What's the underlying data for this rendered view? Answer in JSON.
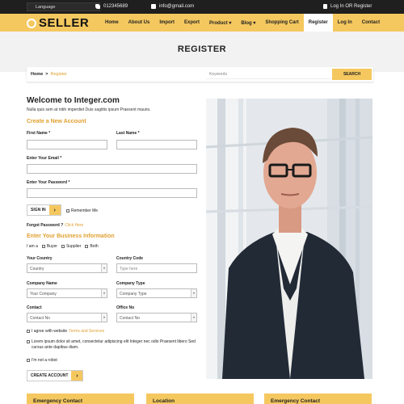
{
  "topbar": {
    "language": "Language",
    "phone": "012345689",
    "email": "info@gmail.com",
    "auth": "Log In OR Register"
  },
  "brand": {
    "name": "SELLER",
    "accent": "#f5c85f"
  },
  "nav": {
    "items": [
      {
        "label": "Home"
      },
      {
        "label": "About Us"
      },
      {
        "label": "Import"
      },
      {
        "label": "Export"
      },
      {
        "label": "Product ▾"
      },
      {
        "label": "Blog ▾"
      },
      {
        "label": "Shopping Cart"
      },
      {
        "label": "Register",
        "active": true
      },
      {
        "label": "Log In"
      },
      {
        "label": "Contact"
      }
    ]
  },
  "page": {
    "title": "REGISTER"
  },
  "breadcrumb": {
    "home": "Home",
    "sep": ">",
    "current": "Register"
  },
  "search": {
    "placeholder": "Keywords",
    "button": "SEARCH"
  },
  "form": {
    "welcome": "Welcome to Integer.com",
    "subtitle": "Nulla quis sem at nibh imperdiet Duis sagittis ipsum Praesent mauris.",
    "create_title": "Create a New Account",
    "first_name": "First Name *",
    "last_name": "Last Name *",
    "email_label": "Enter Your Email *",
    "password_label": "Enter Your Password *",
    "sign_in": "SIGN IN",
    "remember": "Remember Me",
    "forgot": "Forgot Password ?",
    "click_here": "Click Here",
    "business_title": "Enter Your Business Information",
    "i_am": "I am a",
    "buyer": "Buyer",
    "supplier": "Supplier",
    "both": "Both",
    "your_country_label": "Your Country",
    "country_placeholder": "Country",
    "country_code_label": "Country Code",
    "code_placeholder": "Type here",
    "company_name_label": "Company Name",
    "company_placeholder": "Your Company",
    "company_type_label": "Company Type",
    "company_type_placeholder": "Company Type",
    "contact_label": "Contact",
    "contact_placeholder": "Contact No",
    "office_label": "Office No",
    "office_placeholder": "Contact No",
    "agree_text": "I agree with website",
    "terms": "Terms and Services",
    "lorem": "Lorem ipsum dolor sit amet, consectetur adipiscing elit Integer nec odio Praesent libero Sed cursus ante dapibus diam.",
    "robot": "I'm not a robot",
    "create_account": "CREATE ACCOUNT"
  },
  "footer": {
    "cards": [
      {
        "title": "Emergency Contact"
      },
      {
        "title": "Location"
      },
      {
        "title": "Emergency Contact"
      }
    ]
  }
}
